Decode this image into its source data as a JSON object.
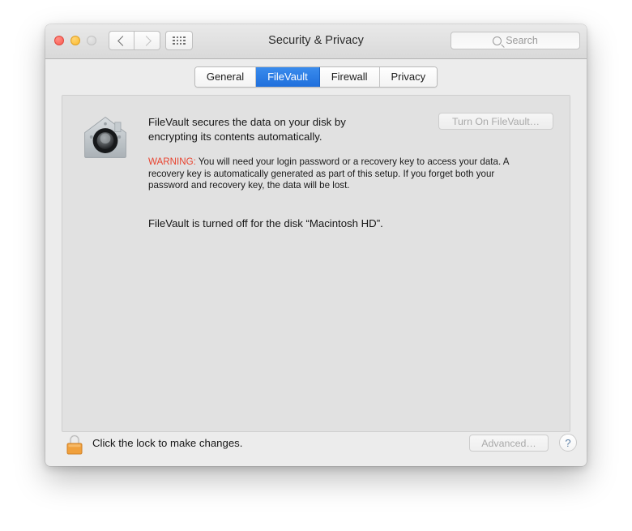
{
  "window": {
    "title": "Security & Privacy",
    "traffic_lights": [
      {
        "name": "close",
        "color": "#fb5b50",
        "enabled": true
      },
      {
        "name": "minimize",
        "color": "#fcbc2d",
        "enabled": true
      },
      {
        "name": "zoom",
        "color": "#d4d4d4",
        "enabled": false
      }
    ],
    "nav": {
      "back_icon": "chevron-left-icon",
      "forward_icon": "chevron-right-icon",
      "grid_icon": "show-all-grid-icon"
    },
    "search": {
      "placeholder": "Search",
      "value": "",
      "icon": "search-icon"
    }
  },
  "tabs": [
    {
      "label": "General",
      "selected": false
    },
    {
      "label": "FileVault",
      "selected": true
    },
    {
      "label": "Firewall",
      "selected": false
    },
    {
      "label": "Privacy",
      "selected": false
    }
  ],
  "filevault": {
    "icon": "filevault-house-icon",
    "intro": "FileVault secures the data on your disk by encrypting its contents automatically.",
    "warning_label": "WARNING:",
    "warning_text": "You will need your login password or a recovery key to access your data. A recovery key is automatically generated as part of this setup. If you forget both your password and recovery key, the data will be lost.",
    "status": "FileVault is turned off for the disk “Macintosh HD”.",
    "turn_on_button": "Turn On FileVault…"
  },
  "bottom": {
    "lock_icon": "closed-padlock-icon",
    "lock_text": "Click the lock to make changes.",
    "advanced_button": "Advanced…",
    "help_button": "?"
  },
  "colors": {
    "accent_blue": "#1f6fdc",
    "warning_red": "#e8432f",
    "lock_gold": "#f0a03c",
    "window_bg": "#ececec",
    "panel_bg": "#e1e1e1"
  }
}
